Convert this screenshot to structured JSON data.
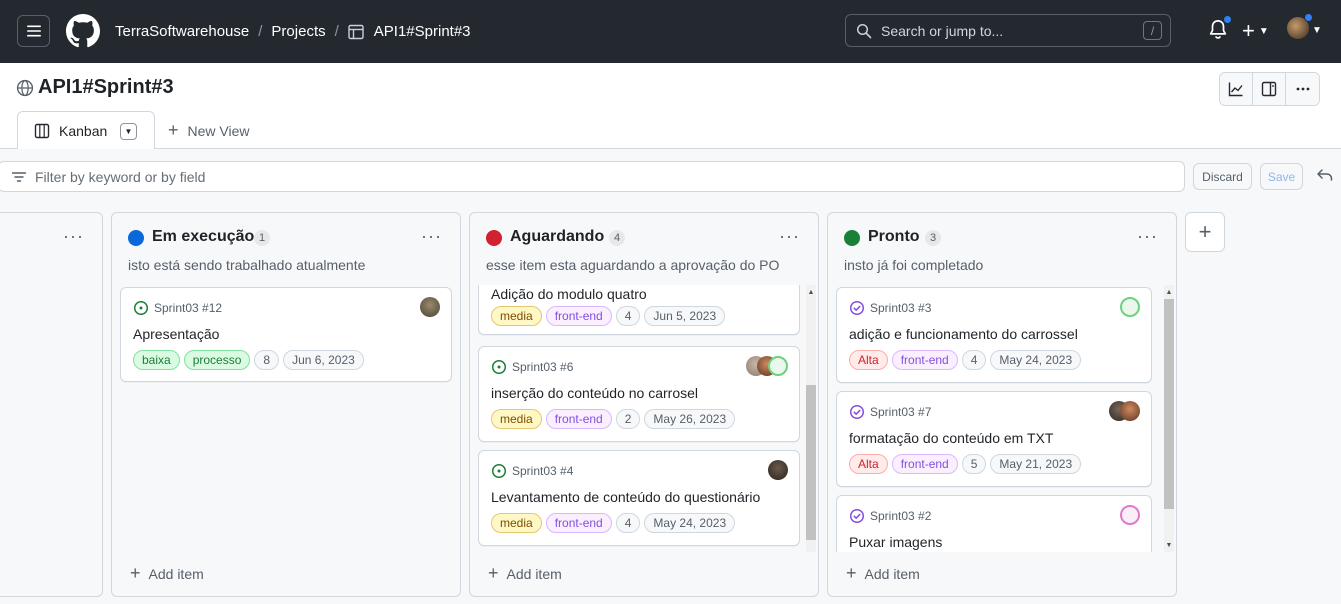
{
  "header": {
    "org": "TerraSoftwarehouse",
    "projects": "Projects",
    "project": "API1#Sprint#3",
    "search_placeholder": "Search or jump to...",
    "search_shortcut": "/",
    "plus": "+"
  },
  "project": {
    "title": "API1#Sprint#3",
    "view_tab": "Kanban",
    "new_view": "New View"
  },
  "filter": {
    "placeholder": "Filter by keyword or by field",
    "discard": "Discard",
    "save": "Save"
  },
  "columns": [
    {
      "name": "Em execução",
      "count": "1",
      "description": "isto está sendo trabalhado atualmente",
      "color": "#0969da",
      "add_item": "Add item",
      "cards": [
        {
          "ref": "Sprint03 #12",
          "title": "Apresentação",
          "tags": [
            "baixa",
            "processo"
          ],
          "num": "8",
          "date": "Jun 6, 2023"
        }
      ]
    },
    {
      "name": "Aguardando",
      "count": "4",
      "description": "esse item esta aguardando a aprovação do PO",
      "color": "#cf222e",
      "add_item": "Add item",
      "cards": [
        {
          "ref": "",
          "title": "Adição do modulo quatro",
          "tags": [
            "media",
            "front-end"
          ],
          "num": "4",
          "date": "Jun 5, 2023"
        },
        {
          "ref": "Sprint03 #6",
          "title": "inserção do conteúdo no carrosel",
          "tags": [
            "media",
            "front-end"
          ],
          "num": "2",
          "date": "May 26, 2023"
        },
        {
          "ref": "Sprint03 #4",
          "title": "Levantamento de conteúdo do questionário",
          "tags": [
            "media",
            "front-end"
          ],
          "num": "4",
          "date": "May 24, 2023"
        }
      ]
    },
    {
      "name": "Pronto",
      "count": "3",
      "description": "insto já foi completado",
      "color": "#1a7f37",
      "add_item": "Add item",
      "cards": [
        {
          "ref": "Sprint03 #3",
          "title": "adição e funcionamento do carrossel",
          "tags": [
            "Alta",
            "front-end"
          ],
          "num": "4",
          "date": "May 24, 2023"
        },
        {
          "ref": "Sprint03 #7",
          "title": "formatação do conteúdo em TXT",
          "tags": [
            "Alta",
            "front-end"
          ],
          "num": "5",
          "date": "May 21, 2023"
        },
        {
          "ref": "Sprint03 #2",
          "title": "Puxar imagens",
          "tags": [],
          "num": "",
          "date": ""
        }
      ]
    }
  ],
  "icons": {
    "menu": "hamburger-icon",
    "logo": "github-logo-icon",
    "table": "table-icon",
    "search": "search-icon",
    "bell": "bell-icon",
    "globe": "globe-icon",
    "chart": "chart-icon",
    "panel": "sidebar-panel-icon",
    "kebab": "kebab-icon",
    "kanban": "kanban-icon",
    "filter": "filter-icon",
    "undo": "undo-icon",
    "open_issue": "issue-open-icon",
    "closed_issue": "issue-closed-icon"
  }
}
